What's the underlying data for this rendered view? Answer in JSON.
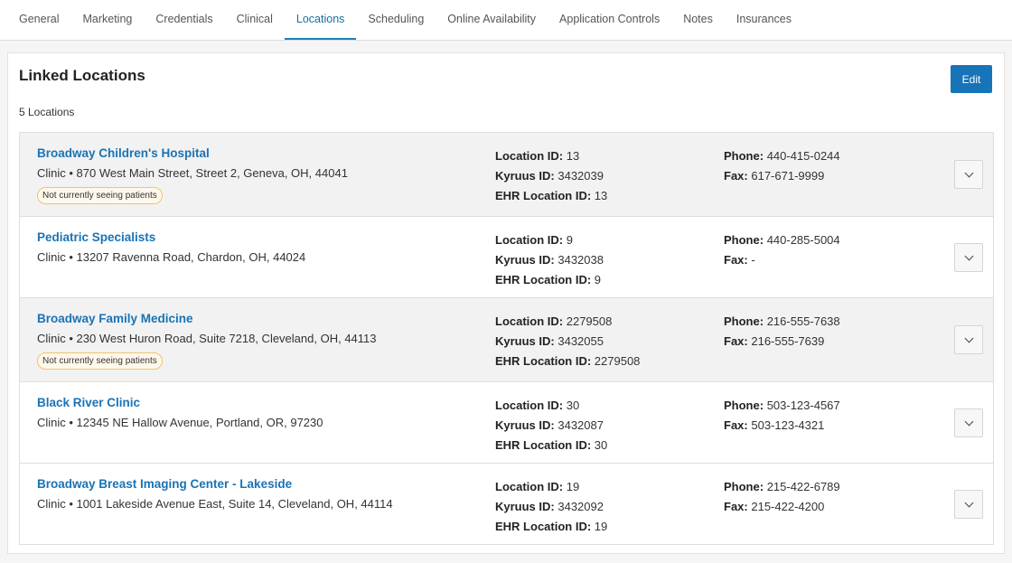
{
  "tabs": [
    {
      "label": "General",
      "active": false
    },
    {
      "label": "Marketing",
      "active": false
    },
    {
      "label": "Credentials",
      "active": false
    },
    {
      "label": "Clinical",
      "active": false
    },
    {
      "label": "Locations",
      "active": true
    },
    {
      "label": "Scheduling",
      "active": false
    },
    {
      "label": "Online Availability",
      "active": false
    },
    {
      "label": "Application Controls",
      "active": false
    },
    {
      "label": "Notes",
      "active": false
    },
    {
      "label": "Insurances",
      "active": false
    }
  ],
  "panel": {
    "title": "Linked Locations",
    "edit_label": "Edit",
    "count_text": "5 Locations"
  },
  "labels": {
    "location_id": "Location ID:",
    "kyruus_id": "Kyruus ID:",
    "ehr_location_id": "EHR Location ID:",
    "phone": "Phone:",
    "fax": "Fax:"
  },
  "locations": [
    {
      "name": "Broadway Children's Hospital",
      "address": "Clinic • 870 West Main Street, Street 2, Geneva, OH, 44041",
      "badge": "Not currently seeing patients",
      "location_id": "13",
      "kyruus_id": "3432039",
      "ehr_location_id": "13",
      "phone": "440-415-0244",
      "fax": "617-671-9999"
    },
    {
      "name": "Pediatric Specialists",
      "address": "Clinic • 13207 Ravenna Road, Chardon, OH, 44024",
      "badge": "",
      "location_id": "9",
      "kyruus_id": "3432038",
      "ehr_location_id": "9",
      "phone": "440-285-5004",
      "fax": "-"
    },
    {
      "name": "Broadway Family Medicine",
      "address": "Clinic • 230 West Huron Road, Suite 7218, Cleveland, OH, 44113",
      "badge": "Not currently seeing patients",
      "location_id": "2279508",
      "kyruus_id": "3432055",
      "ehr_location_id": "2279508",
      "phone": "216-555-7638",
      "fax": "216-555-7639"
    },
    {
      "name": "Black River Clinic",
      "address": "Clinic • 12345 NE Hallow Avenue, Portland, OR, 97230",
      "badge": "",
      "location_id": "30",
      "kyruus_id": "3432087",
      "ehr_location_id": "30",
      "phone": "503-123-4567",
      "fax": "503-123-4321"
    },
    {
      "name": "Broadway Breast Imaging Center - Lakeside",
      "address": "Clinic • 1001 Lakeside Avenue East, Suite 14, Cleveland, OH, 44114",
      "badge": "",
      "location_id": "19",
      "kyruus_id": "3432092",
      "ehr_location_id": "19",
      "phone": "215-422-6789",
      "fax": "215-422-4200"
    }
  ]
}
